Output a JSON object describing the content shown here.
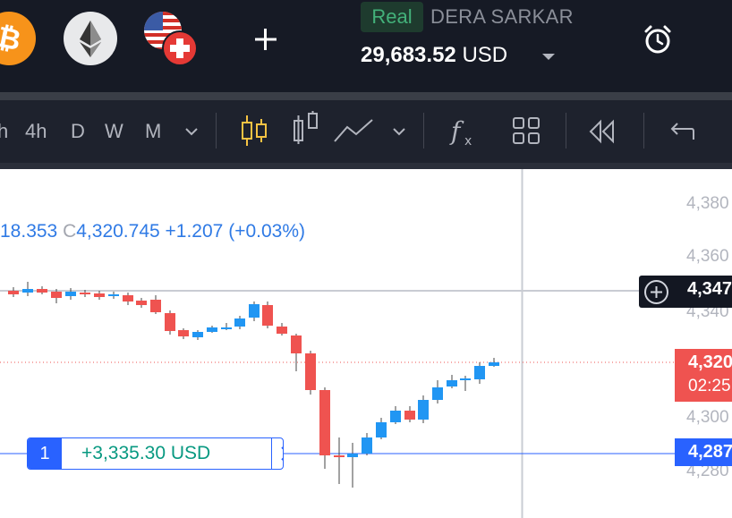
{
  "header": {
    "coins": [
      {
        "name": "bitcoin-icon",
        "color": "#f7931a"
      },
      {
        "name": "ethereum-icon",
        "color": "#e8e9eb"
      },
      {
        "name": "us-swiss-flag-icon"
      }
    ],
    "account_type": "Real",
    "account_name": "DERA SARKAR",
    "balance": "29,683.52",
    "currency": "USD"
  },
  "toolbar": {
    "timeframes": [
      "h",
      "4h",
      "D",
      "W",
      "M"
    ],
    "icons": [
      "chevron-down-icon",
      "candles-icon",
      "bars-icon",
      "line-icon",
      "chevron-down-icon",
      "indicator-fx-icon",
      "layout-icon",
      "rewind-icon",
      "undo-icon"
    ]
  },
  "legend": {
    "open_partial": "18.353",
    "close_label": "C",
    "close_value": "4,320.745",
    "change": "+1.207",
    "change_pct": "(+0.03%)"
  },
  "price_axis": {
    "labels": [
      "4,380",
      "4,360",
      "4,340",
      "4,300",
      "4,280"
    ],
    "crosshair_price": "4,347",
    "current_price": "4,320",
    "countdown": "02:25",
    "position_price": "4,287"
  },
  "position": {
    "quantity": "1",
    "pnl": "+3,335.30 USD"
  },
  "colors": {
    "up": "#2196f3",
    "down": "#ef5350",
    "position": "#2962ff",
    "pnl": "#089981"
  }
}
